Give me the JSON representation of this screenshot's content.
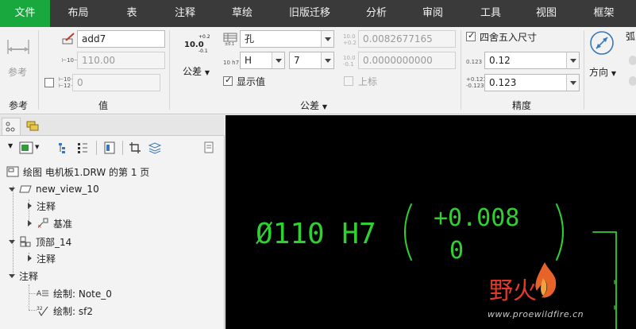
{
  "menu": {
    "items": [
      {
        "label": "文件",
        "active": true
      },
      {
        "label": "布局",
        "active": false
      },
      {
        "label": "表",
        "active": false
      },
      {
        "label": "注释",
        "active": false
      },
      {
        "label": "草绘",
        "active": false
      },
      {
        "label": "旧版迁移",
        "active": false
      },
      {
        "label": "分析",
        "active": false
      },
      {
        "label": "审阅",
        "active": false
      },
      {
        "label": "工具",
        "active": false
      },
      {
        "label": "视图",
        "active": false
      },
      {
        "label": "框架",
        "active": false
      }
    ]
  },
  "ribbon": {
    "reference": {
      "button_label": "参考",
      "group_title": "参考"
    },
    "value": {
      "name_field": "add7",
      "nominal_field": "110.00",
      "override_field": "0",
      "override_checked": false,
      "group_title": "值"
    },
    "tolerance": {
      "tolerance_button_label": "公差",
      "tolerance_icon_text": "10.0",
      "tolerance_icon_sup": "+0.2",
      "tolerance_icon_sub": "-0.1",
      "table_select": "孔",
      "class_select": "H",
      "grade_select": "7",
      "upper_value": "0.0082677165",
      "lower_value": "0.0000000000",
      "show_value_label": "显示值",
      "show_value_checked": true,
      "superscript_label": "上标",
      "superscript_checked": false,
      "group_title": "公差"
    },
    "precision": {
      "round_label": "四舍五入尺寸",
      "round_checked": true,
      "decimals_primary": "0.12",
      "decimals_tolerance": "0.123",
      "group_title": "精度"
    },
    "direction": {
      "button_label": "方向"
    },
    "arc": {
      "label": "弧"
    }
  },
  "panel": {
    "tree": [
      {
        "label": "绘图 电机板1.DRW 的第 1 页",
        "icon": "drawing-sheet-icon"
      },
      {
        "label": "new_view_10",
        "icon": "view-icon"
      },
      {
        "label": "注释",
        "icon": ""
      },
      {
        "label": "基准",
        "icon": "datum-icon"
      },
      {
        "label": "顶部_14",
        "icon": "view-top-icon"
      },
      {
        "label": "注释",
        "icon": ""
      },
      {
        "label": "注释",
        "icon": ""
      },
      {
        "label": "绘制: Note_0",
        "icon": "note-icon"
      },
      {
        "label": "绘制: sf2",
        "icon": "surface-finish-icon"
      }
    ]
  },
  "canvas": {
    "dimension_text": "Ø110 H7",
    "tolerance_upper": "+0.008",
    "tolerance_lower": "0",
    "watermark_cn": "野火",
    "watermark_url": "www.proewildfire.cn",
    "annotation_color": "#2fd02f",
    "background_color": "#000000"
  }
}
